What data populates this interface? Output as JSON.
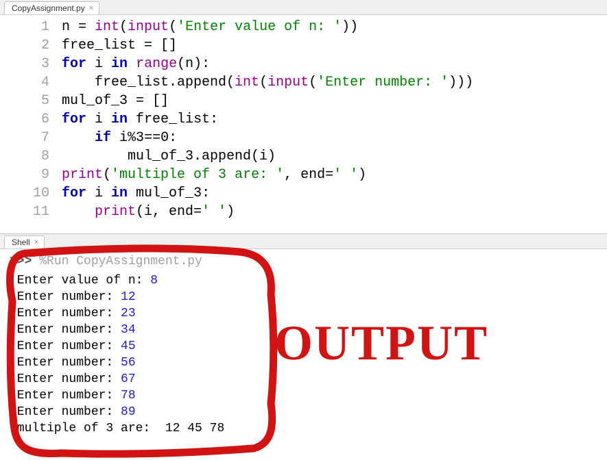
{
  "editor": {
    "tab_label": "CopyAssignment.py",
    "lines": [
      {
        "n": "1",
        "html": "n = <span class='builtin'>int</span>(<span class='builtin'>input</span>(<span class='str'>'Enter value of n: '</span>))"
      },
      {
        "n": "2",
        "html": "free_list = []"
      },
      {
        "n": "3",
        "html": "<span class='kw'>for</span> i <span class='kw'>in</span> <span class='builtin'>range</span>(n):"
      },
      {
        "n": "4",
        "html": "    free_list.append(<span class='builtin'>int</span>(<span class='builtin'>input</span>(<span class='str'>'Enter number: '</span>)))"
      },
      {
        "n": "5",
        "html": "mul_of_3 = []"
      },
      {
        "n": "6",
        "html": "<span class='kw'>for</span> i <span class='kw'>in</span> free_list:"
      },
      {
        "n": "7",
        "html": "    <span class='kw'>if</span> i%<span class='num'>3</span>==<span class='num'>0</span>:"
      },
      {
        "n": "8",
        "html": "        mul_of_3.append(i)"
      },
      {
        "n": "9",
        "html": "<span class='builtin'>print</span>(<span class='str'>'multiple of 3 are: '</span>, end=<span class='str'>' '</span>)"
      },
      {
        "n": "10",
        "html": "<span class='kw'>for</span> i <span class='kw'>in</span> mul_of_3:"
      },
      {
        "n": "11",
        "html": "    <span class='builtin'>print</span>(i, end=<span class='str'>' '</span>)"
      }
    ]
  },
  "shell": {
    "tab_label": "Shell",
    "prompt": ">>>",
    "run_cmd": "%Run CopyAssignment.py",
    "io": [
      {
        "prompt": "Enter value of n: ",
        "val": "8"
      },
      {
        "prompt": "Enter number: ",
        "val": "12"
      },
      {
        "prompt": "Enter number: ",
        "val": "23"
      },
      {
        "prompt": "Enter number: ",
        "val": "34"
      },
      {
        "prompt": "Enter number: ",
        "val": "45"
      },
      {
        "prompt": "Enter number: ",
        "val": "56"
      },
      {
        "prompt": "Enter number: ",
        "val": "67"
      },
      {
        "prompt": "Enter number: ",
        "val": "78"
      },
      {
        "prompt": "Enter number: ",
        "val": "89"
      }
    ],
    "result_label": "multiple of 3 are:  ",
    "result_values": "12 45 78"
  },
  "annotation": {
    "label": "OUTPUT",
    "color": "#d11313"
  }
}
